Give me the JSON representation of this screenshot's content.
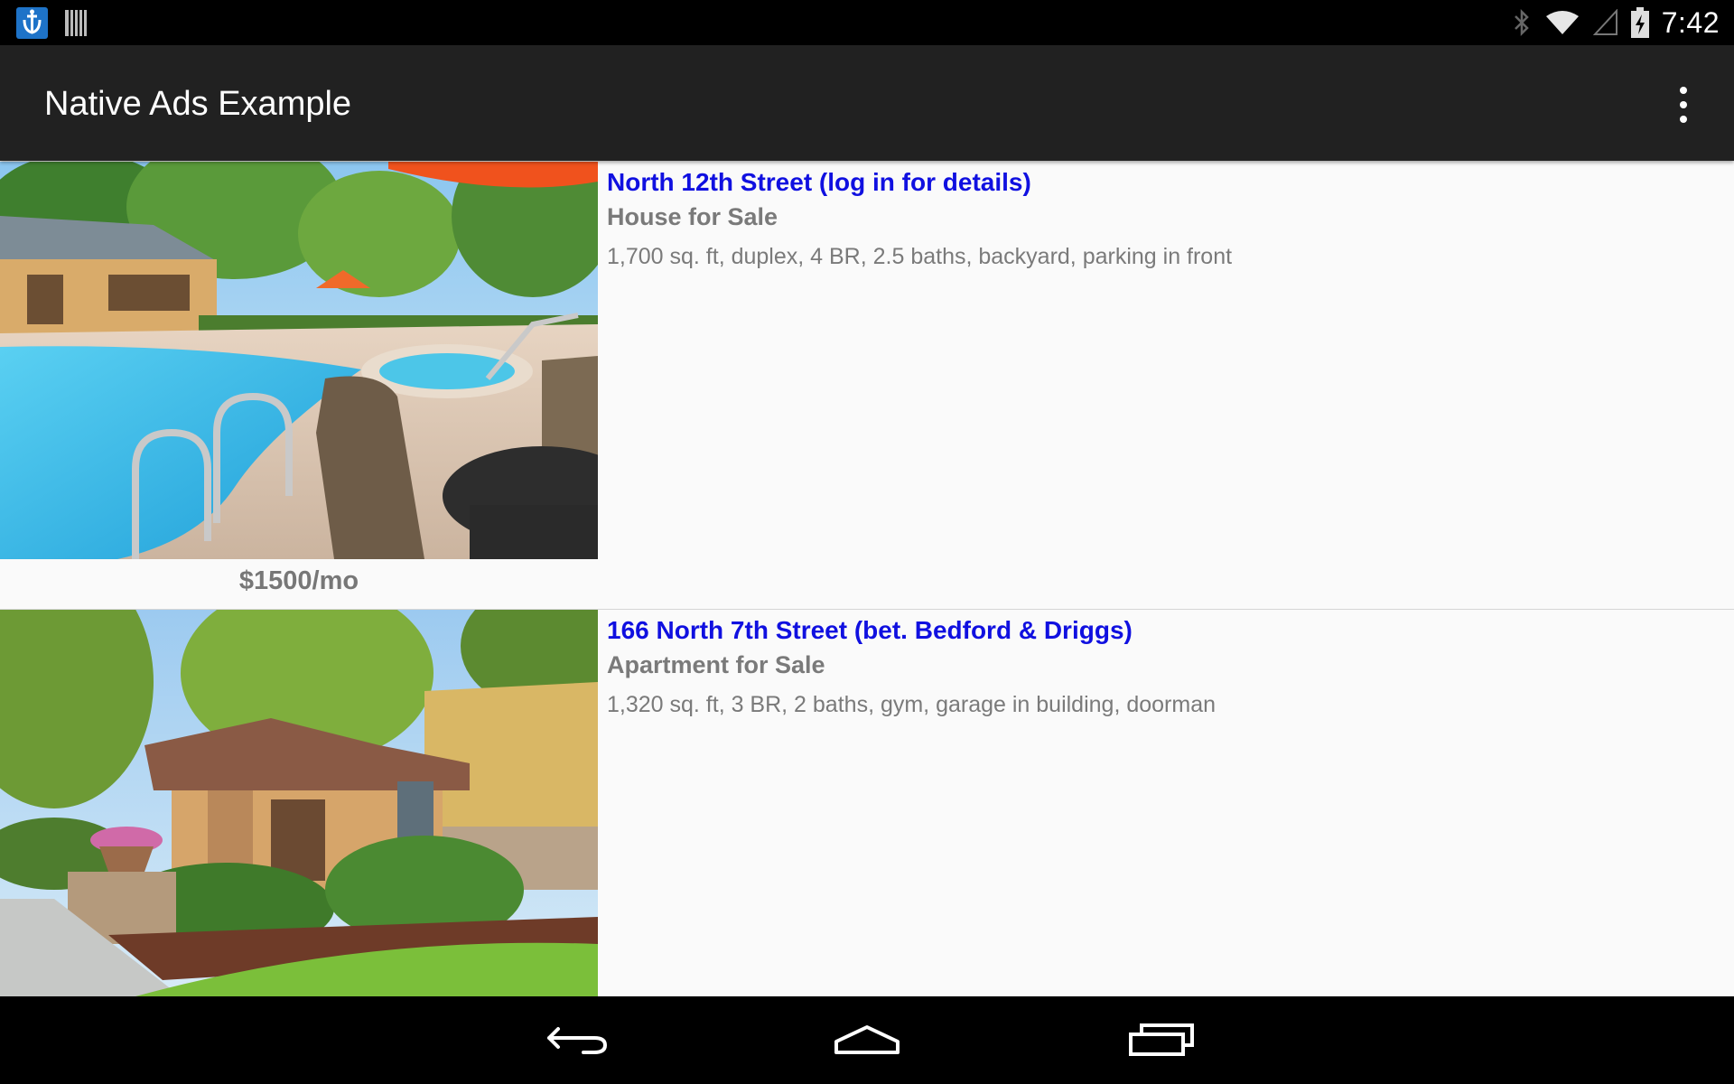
{
  "status_bar": {
    "time": "7:42",
    "icons": [
      "app-notification-icon",
      "barcode-icon",
      "bluetooth-icon",
      "wifi-icon",
      "signal-icon",
      "battery-charging-icon"
    ]
  },
  "action_bar": {
    "title": "Native Ads Example",
    "overflow_icon": "overflow-menu-icon"
  },
  "listings": [
    {
      "title": "North 12th Street (log in for details)",
      "subtitle": "House for Sale",
      "description": "1,700 sq. ft, duplex, 4 BR, 2.5 baths, backyard, parking in front",
      "price": "$1500/mo",
      "image": "pool-patio-photo"
    },
    {
      "title": "166 North 7th Street (bet. Bedford & Driggs)",
      "subtitle": "Apartment for Sale",
      "description": "1,320 sq. ft, 3 BR, 2 baths, gym, garage in building, doorman",
      "image": "house-garden-photo"
    }
  ],
  "nav_bar": {
    "buttons": [
      "back-icon",
      "home-icon",
      "recents-icon"
    ]
  }
}
